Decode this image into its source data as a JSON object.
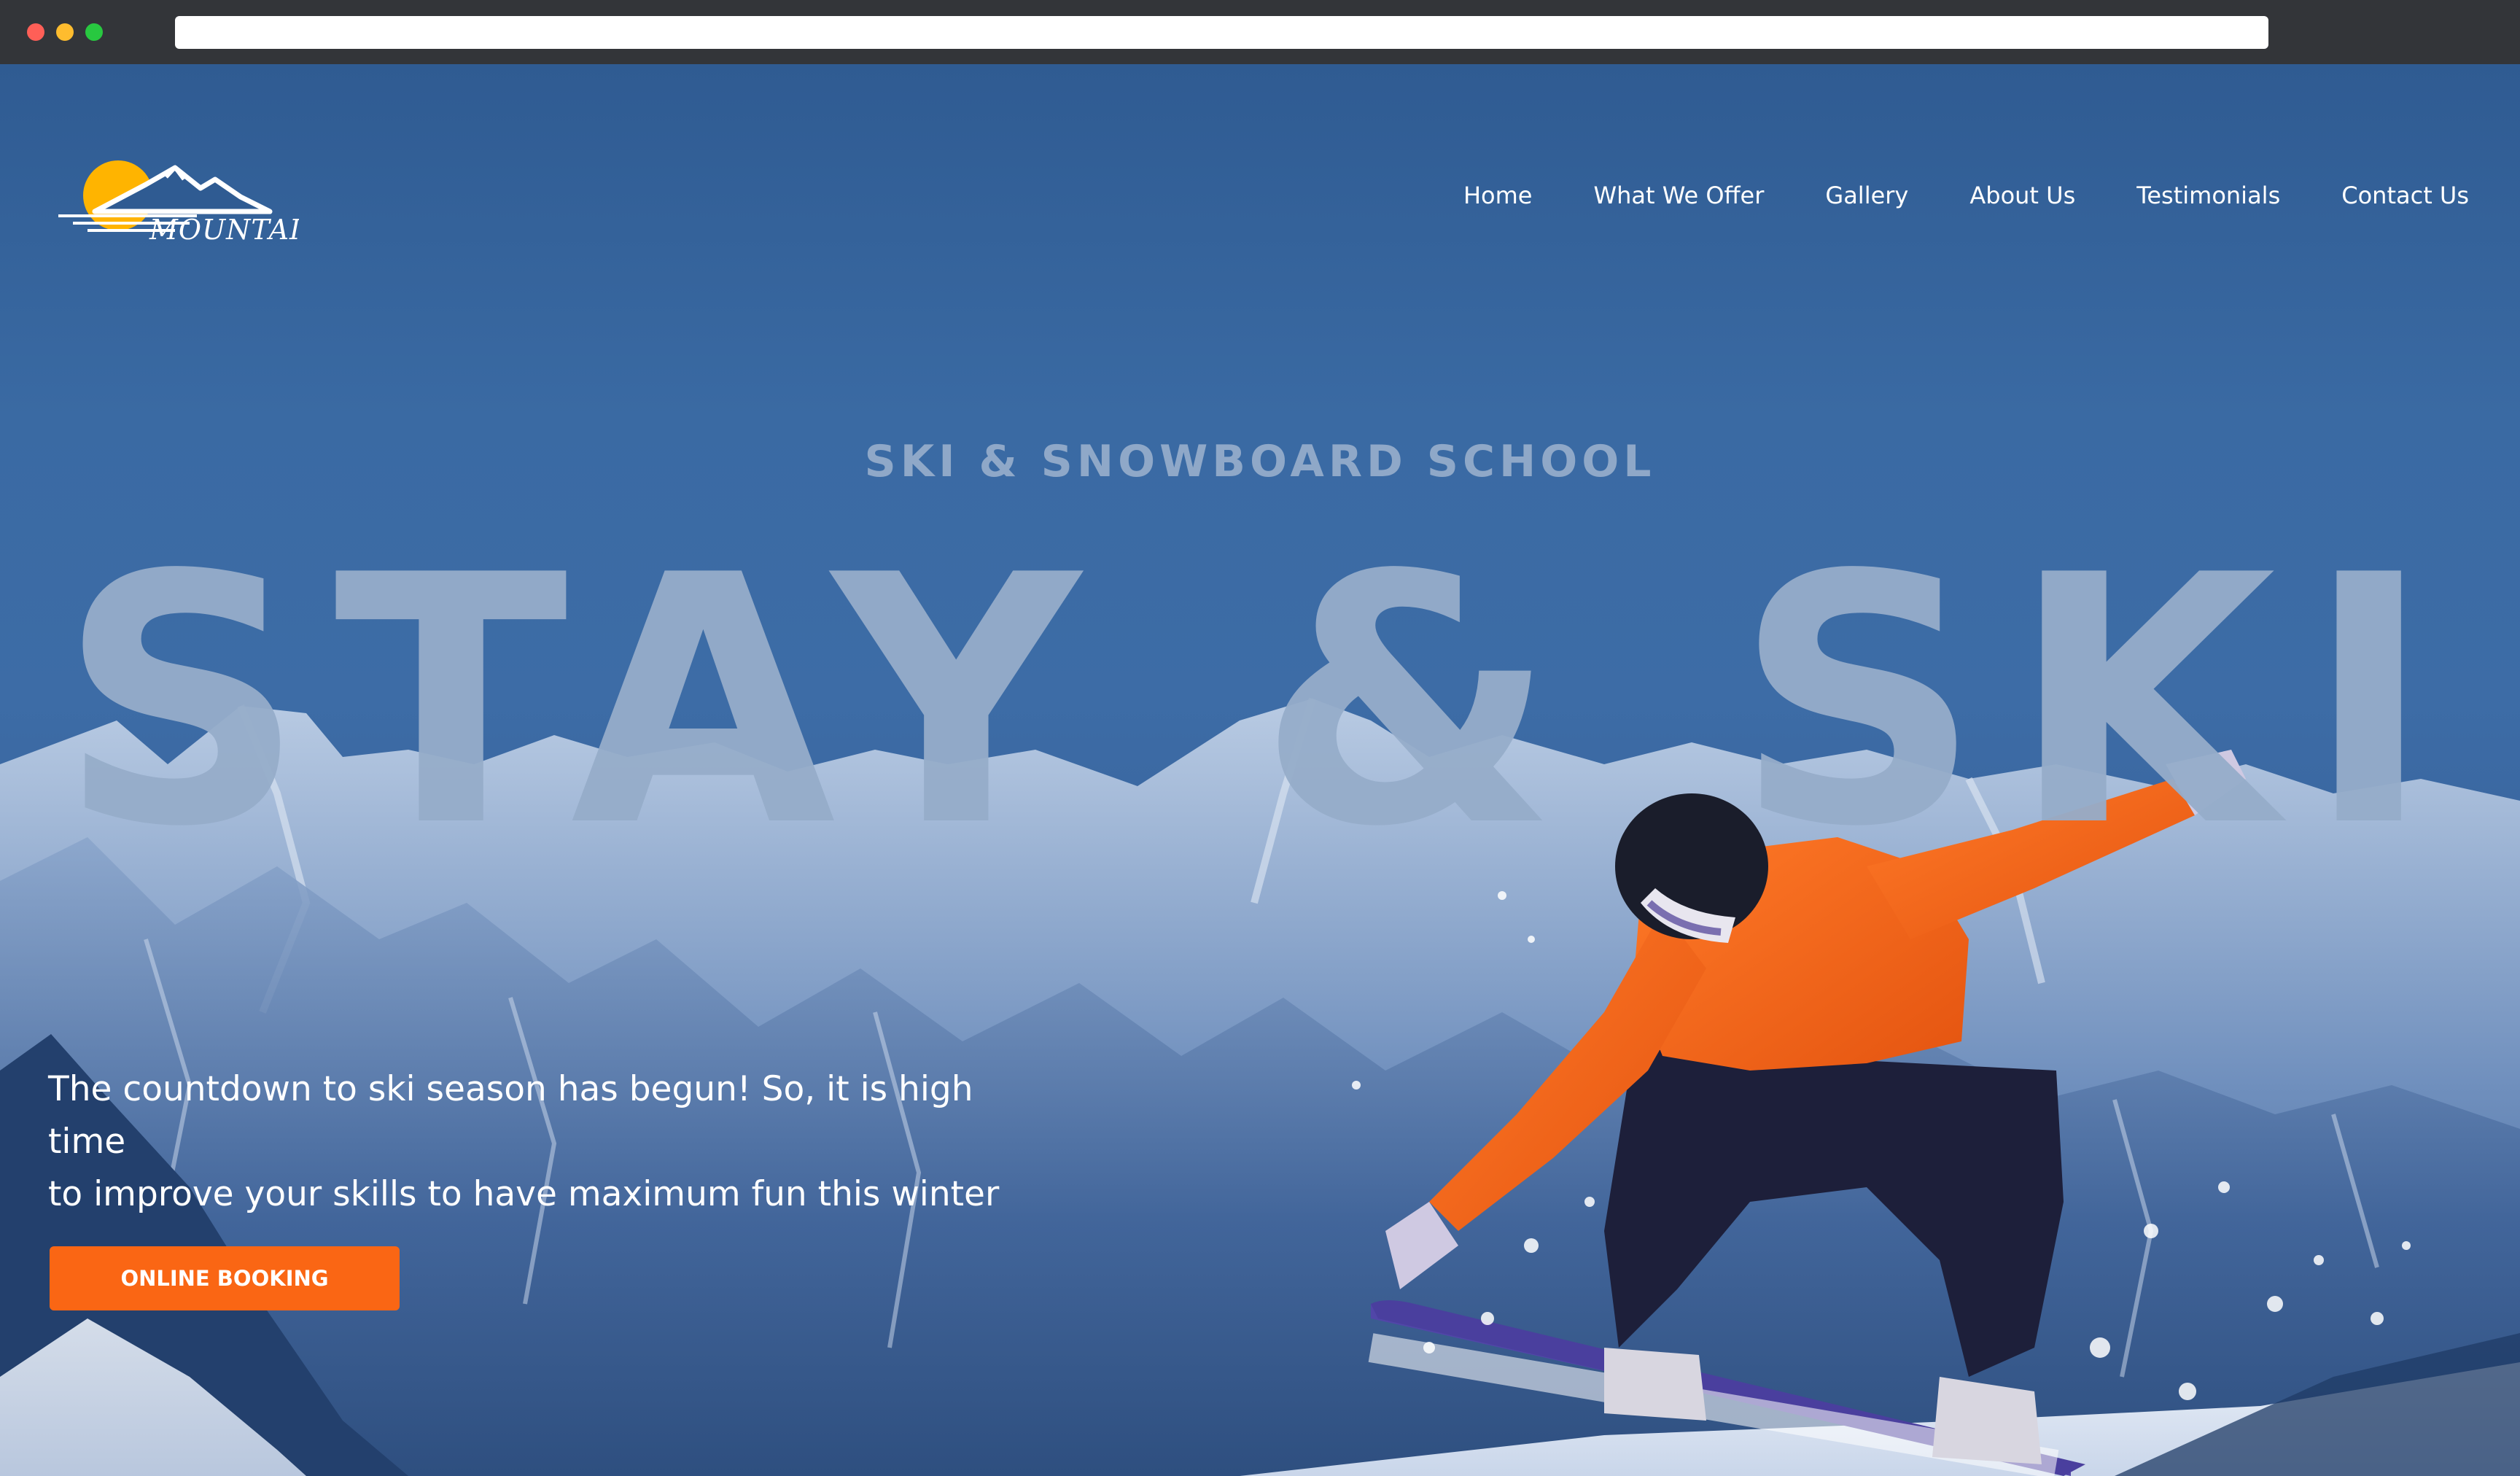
{
  "browser": {
    "window_buttons": [
      "close",
      "minimize",
      "maximize"
    ],
    "address_bar_value": ""
  },
  "brand": {
    "logo_text": "MOUNTAIN",
    "sun_color": "#ffb400",
    "accent_color": "#fa6614"
  },
  "nav": {
    "items": [
      {
        "label": "Home"
      },
      {
        "label": "What We Offer"
      },
      {
        "label": "Gallery"
      },
      {
        "label": "About Us"
      },
      {
        "label": "Testimonials"
      },
      {
        "label": "Contact Us"
      }
    ]
  },
  "hero": {
    "kicker": "SKI & SNOWBOARD SCHOOL",
    "title": "STAY & SKI",
    "tagline_line1": "The countdown to ski season has begun! So, it is high time",
    "tagline_line2": "to improve your skills to have maximum fun this winter",
    "cta_label": "ONLINE BOOKING"
  }
}
